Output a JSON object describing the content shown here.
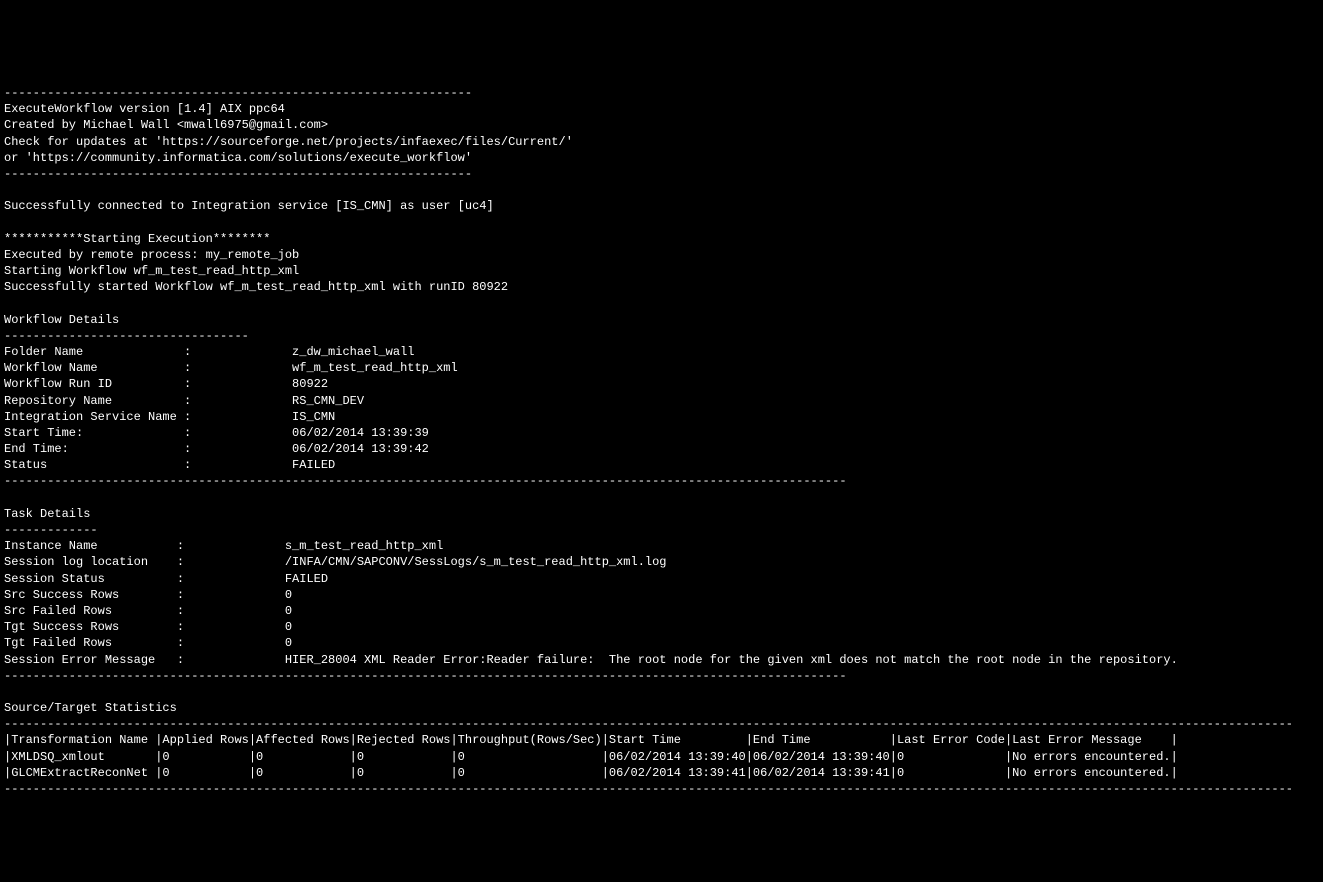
{
  "header": {
    "sep": "-----------------------------------------------------------------",
    "line1": "ExecuteWorkflow version [1.4] AIX ppc64",
    "line2": "Created by Michael Wall <mwall6975@gmail.com>",
    "line3": "Check for updates at 'https://sourceforge.net/projects/infaexec/files/Current/'",
    "line4": "or 'https://community.informatica.com/solutions/execute_workflow'"
  },
  "connection": {
    "text": "Successfully connected to Integration service [IS_CMN] as user [uc4]"
  },
  "execution": {
    "title": "***********Starting Execution********",
    "line1": "Executed by remote process: my_remote_job",
    "line2": "Starting Workflow wf_m_test_read_http_xml",
    "line3": "Successfully started Workflow wf_m_test_read_http_xml with runID 80922"
  },
  "workflow_details": {
    "title": "Workflow Details",
    "sep": "----------------------------------",
    "folder_label": "Folder Name              :              z_dw_michael_wall",
    "workflow_label": "Workflow Name            :              wf_m_test_read_http_xml",
    "runid_label": "Workflow Run ID          :              80922",
    "repo_label": "Repository Name          :              RS_CMN_DEV",
    "is_label": "Integration Service Name :              IS_CMN",
    "start_label": "Start Time:              :              06/02/2014 13:39:39",
    "end_label": "End Time:                :              06/02/2014 13:39:42",
    "status_label": "Status                   :              FAILED",
    "long_sep": "---------------------------------------------------------------------------------------------------------------------"
  },
  "task_details": {
    "title": "Task Details",
    "sep": "-------------",
    "instance": "Instance Name           :              s_m_test_read_http_xml",
    "loglocation": "Session log location    :              /INFA/CMN/SAPCONV/SessLogs/s_m_test_read_http_xml.log",
    "status": "Session Status          :              FAILED",
    "src_success": "Src Success Rows        :              0",
    "src_failed": "Src Failed Rows         :              0",
    "tgt_success": "Tgt Success Rows        :              0",
    "tgt_failed": "Tgt Failed Rows         :              0",
    "error_msg": "Session Error Message   :              HIER_28004 XML Reader Error:Reader failure:  The root node for the given xml does not match the root node in the repository.",
    "long_sep": "---------------------------------------------------------------------------------------------------------------------"
  },
  "statistics": {
    "title": "Source/Target Statistics",
    "sep": "-----------------------------------------------------------------------------------------------------------------------------------------------------------------------------------",
    "header": "|Transformation Name |Applied Rows|Affected Rows|Rejected Rows|Throughput(Rows/Sec)|Start Time         |End Time           |Last Error Code|Last Error Message    |",
    "row1": "|XMLDSQ_xmlout       |0           |0            |0            |0                   |06/02/2014 13:39:40|06/02/2014 13:39:40|0              |No errors encountered.|",
    "row2": "|GLCMExtractReconNet |0           |0            |0            |0                   |06/02/2014 13:39:41|06/02/2014 13:39:41|0              |No errors encountered.|"
  }
}
